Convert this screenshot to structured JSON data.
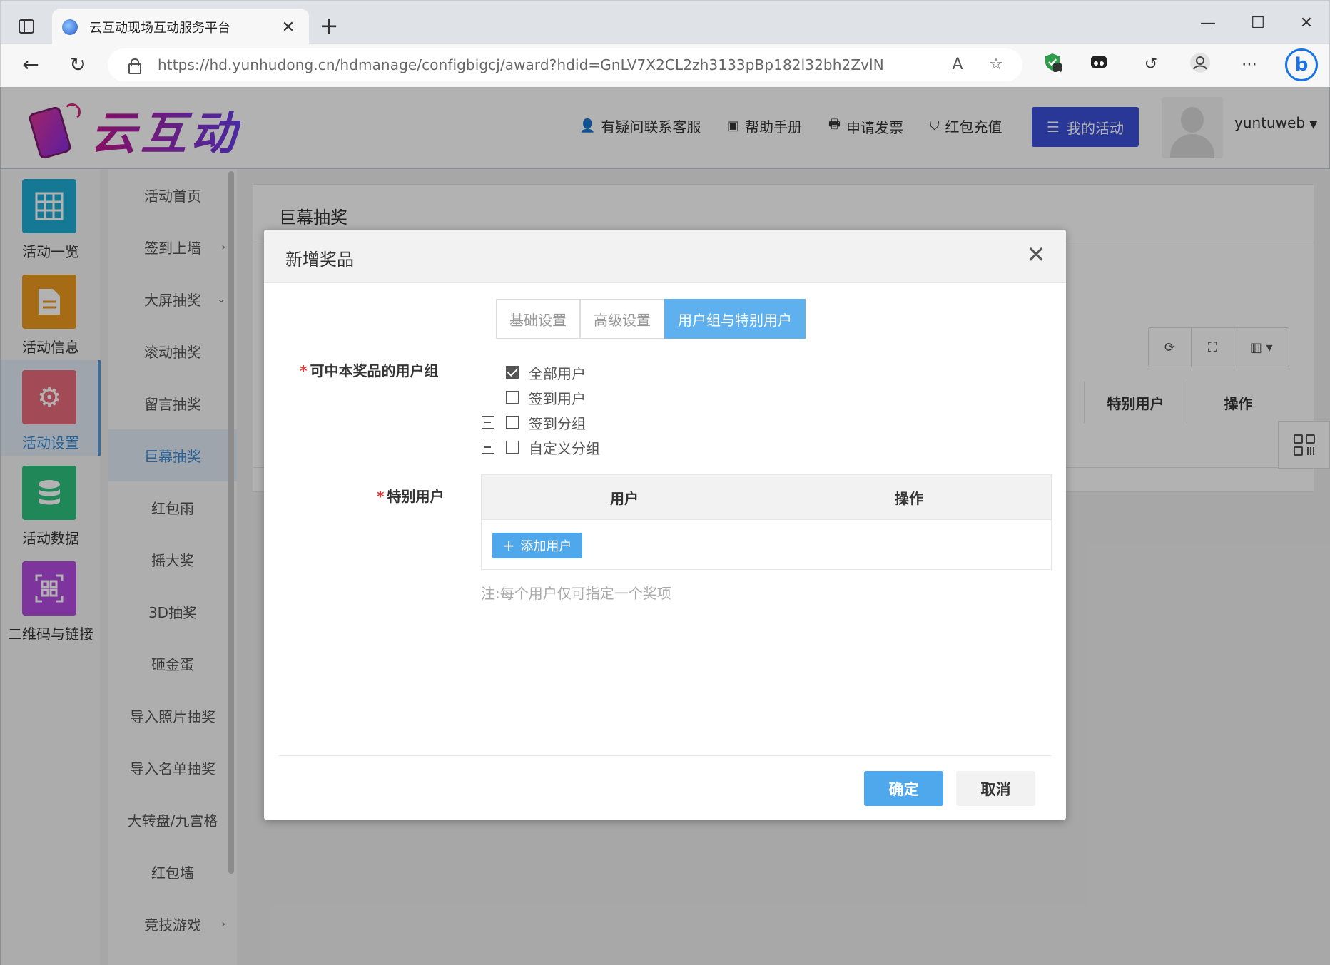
{
  "browser": {
    "tab_title": "云互动现场互动服务平台",
    "url": "https://hd.yunhudong.cn/hdmanage/configbigcj/award?hdid=GnLV7X2CL2zh3133pBp182l32bh2ZvlN",
    "extension_badge": "1"
  },
  "header": {
    "logo_text": "云互动",
    "links": {
      "support": "有疑问联系客服",
      "manual": "帮助手册",
      "invoice": "申请发票",
      "recharge": "红包充值"
    },
    "my_activity": "我的活动",
    "username": "yuntuweb"
  },
  "rail": {
    "items": [
      {
        "label": "活动一览",
        "color": "#1faed6"
      },
      {
        "label": "活动信息",
        "color": "#ee9a1f"
      },
      {
        "label": "活动设置",
        "color": "#e86a7a"
      },
      {
        "label": "活动数据",
        "color": "#2ec27e"
      },
      {
        "label": "二维码与链接",
        "color": "#b44be0"
      }
    ]
  },
  "submenu": {
    "items": [
      {
        "label": "活动首页"
      },
      {
        "label": "签到上墙"
      },
      {
        "label": "大屏抽奖"
      },
      {
        "label": "滚动抽奖"
      },
      {
        "label": "留言抽奖"
      },
      {
        "label": "巨幕抽奖"
      },
      {
        "label": "红包雨"
      },
      {
        "label": "摇大奖"
      },
      {
        "label": "3D抽奖"
      },
      {
        "label": "砸金蛋"
      },
      {
        "label": "导入照片抽奖"
      },
      {
        "label": "导入名单抽奖"
      },
      {
        "label": "大转盘/九宫格"
      },
      {
        "label": "红包墙"
      },
      {
        "label": "竞技游戏"
      }
    ]
  },
  "main": {
    "title": "巨幕抽奖",
    "columns": {
      "special_users": "特别用户",
      "actions": "操作"
    }
  },
  "modal": {
    "title": "新增奖品",
    "tabs": [
      "基础设置",
      "高级设置",
      "用户组与特别用户"
    ],
    "user_group_label": "可中本奖品的用户组",
    "required_mark": "*",
    "groups": [
      {
        "label": "全部用户",
        "checked": true
      },
      {
        "label": "签到用户",
        "checked": false
      },
      {
        "label": "签到分组",
        "checked": false
      },
      {
        "label": "自定义分组",
        "checked": false
      }
    ],
    "special_label": "特别用户",
    "table": {
      "col_user": "用户",
      "col_action": "操作"
    },
    "add_user": "添加用户",
    "note": "注:每个用户仅可指定一个奖项",
    "confirm": "确定",
    "cancel": "取消"
  }
}
